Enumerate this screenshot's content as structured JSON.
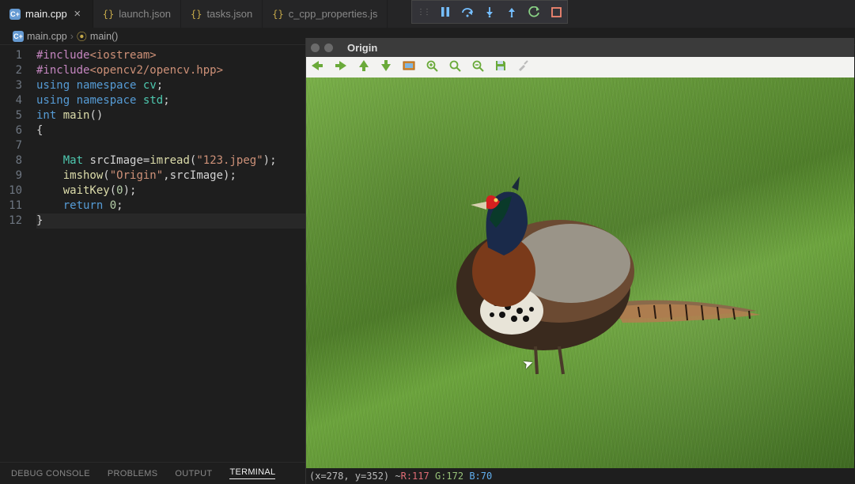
{
  "tabs": [
    {
      "label": "main.cpp",
      "kind": "cpp",
      "active": true,
      "close": true
    },
    {
      "label": "launch.json",
      "kind": "json",
      "active": false,
      "close": false
    },
    {
      "label": "tasks.json",
      "kind": "json",
      "active": false,
      "close": false
    },
    {
      "label": "c_cpp_properties.js",
      "kind": "json",
      "active": false,
      "close": false
    }
  ],
  "breadcrumb": {
    "file": "main.cpp",
    "symbol": "main()"
  },
  "code_lines": [
    1,
    2,
    3,
    4,
    5,
    6,
    7,
    8,
    9,
    10,
    11,
    12
  ],
  "source": {
    "l1": {
      "pre": "#include",
      "inc": "<iostream>"
    },
    "l2": {
      "pre": "#include",
      "inc": "<opencv2/opencv.hpp>"
    },
    "l3": {
      "kw1": "using",
      "kw2": "namespace",
      "ns": "cv",
      "p": ";"
    },
    "l4": {
      "kw1": "using",
      "kw2": "namespace",
      "ns": "std",
      "p": ";"
    },
    "l5": {
      "type": "int",
      "fn": "main",
      "paren": "()"
    },
    "l6": {
      "brace": "{"
    },
    "l7": {
      "blank": ""
    },
    "l8": {
      "type": "Mat",
      "id": "srcImage",
      "eq": "=",
      "fn": "imread",
      "lp": "(",
      "str": "\"123.jpeg\"",
      "rp": ");"
    },
    "l9": {
      "fn": "imshow",
      "lp": "(",
      "str": "\"Origin\"",
      "comma": ",",
      "id": "srcImage",
      "rp": ");"
    },
    "l10": {
      "fn": "waitKey",
      "lp": "(",
      "num": "0",
      "rp": ");"
    },
    "l11": {
      "kw": "return",
      "num": "0",
      "p": ";"
    },
    "l12": {
      "brace": "}"
    }
  },
  "panel_tabs": [
    "DEBUG CONSOLE",
    "PROBLEMS",
    "OUTPUT",
    "TERMINAL"
  ],
  "panel_active": "TERMINAL",
  "image_window": {
    "title": "Origin",
    "status_prefix": "(x=278, y=352) ~ ",
    "R": "R:117",
    "G": "G:172",
    "B": "B:70",
    "toolbar_icons": [
      "arrow-left",
      "arrow-right",
      "arrow-up",
      "arrow-down",
      "rect",
      "zoom-in",
      "zoom-reset",
      "zoom-out",
      "save",
      "brush"
    ]
  },
  "debug_icons": [
    "grip",
    "pause",
    "step-over",
    "step-into",
    "step-out",
    "restart",
    "stop"
  ],
  "colors": {
    "pause": "#75beff",
    "step": "#75beff",
    "restart": "#89d185",
    "stop": "#f48771",
    "arrow_green": "#6aaa3a",
    "arrow_orange": "#d68a2e",
    "save_teal": "#3a8a8a"
  }
}
